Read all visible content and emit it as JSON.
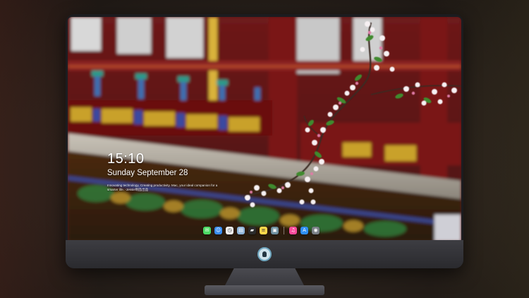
{
  "lockscreen": {
    "time": "15:10",
    "date": "Sunday September 28",
    "subtitle": "Innovating technology, Creating productivity. Mac, your ideal companion for a smarter life. -Jessie制品出品"
  },
  "dock": {
    "apps": [
      {
        "name": "messages",
        "color": "#4cd964",
        "glyph": "✉"
      },
      {
        "name": "finder",
        "color": "#3a8df0",
        "glyph": "☺"
      },
      {
        "name": "clock",
        "color": "#f2f2f2",
        "glyph": "◷"
      },
      {
        "name": "preview",
        "color": "#8fb4d8",
        "glyph": "▤"
      },
      {
        "name": "clapper",
        "color": "#2b2b2b",
        "glyph": "▰"
      },
      {
        "name": "notes",
        "color": "#ffd84a",
        "glyph": "≡"
      },
      {
        "name": "photo-booth",
        "color": "#6d8f9e",
        "glyph": "▣"
      }
    ],
    "apps_right": [
      {
        "name": "music",
        "color": "#fa4a9a",
        "glyph": "♫"
      },
      {
        "name": "app-store",
        "color": "#2f8ff5",
        "glyph": "A"
      },
      {
        "name": "camera",
        "color": "#7a7f86",
        "glyph": "◉"
      }
    ]
  }
}
